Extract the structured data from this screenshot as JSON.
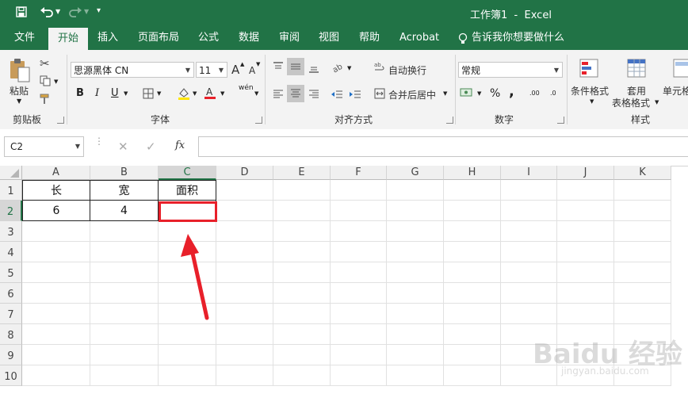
{
  "window": {
    "title": "工作簿1  -  Excel"
  },
  "ribbon_tabs": [
    "文件",
    "开始",
    "插入",
    "页面布局",
    "公式",
    "数据",
    "审阅",
    "视图",
    "帮助",
    "Acrobat"
  ],
  "active_tab": "开始",
  "tell_me": "告诉我你想要做什么",
  "clipboard": {
    "paste_label": "粘贴",
    "group_label": "剪贴板"
  },
  "font": {
    "name": "思源黑体 CN",
    "size": "11",
    "group_label": "字体",
    "bold": "B",
    "italic": "I",
    "underline": "U",
    "grow": "A",
    "shrink": "A",
    "phonetic": "wén"
  },
  "alignment": {
    "wrap_label": "自动换行",
    "merge_label": "合并后居中",
    "group_label": "对齐方式"
  },
  "number": {
    "format": "常规",
    "group_label": "数字",
    "percent": "%",
    "comma": ",",
    "inc_decimal": ".00",
    "dec_decimal": ".0"
  },
  "styles": {
    "conditional_label": "条件格式",
    "table_label_1": "套用",
    "table_label_2": "表格格式",
    "cell_styles_label": "单元格",
    "group_label": "样式"
  },
  "formula_bar": {
    "name_box": "C2",
    "fx": "fx",
    "content": ""
  },
  "grid": {
    "columns": [
      "A",
      "B",
      "C",
      "D",
      "E",
      "F",
      "G",
      "H",
      "I",
      "J",
      "K"
    ],
    "rows": [
      "1",
      "2",
      "3",
      "4",
      "5",
      "6",
      "7",
      "8",
      "9",
      "10"
    ],
    "cells": {
      "A1": "长",
      "B1": "宽",
      "C1": "面积",
      "A2": "6",
      "B2": "4",
      "C2": ""
    },
    "selected": "C2"
  },
  "colors": {
    "excel_green": "#217346",
    "highlight_red": "#e8202a",
    "font_color_red": "#e8202a",
    "fill_yellow": "#ffe600"
  },
  "watermark": {
    "text": "Baidu 经验",
    "url": "jingyan.baidu.com"
  }
}
